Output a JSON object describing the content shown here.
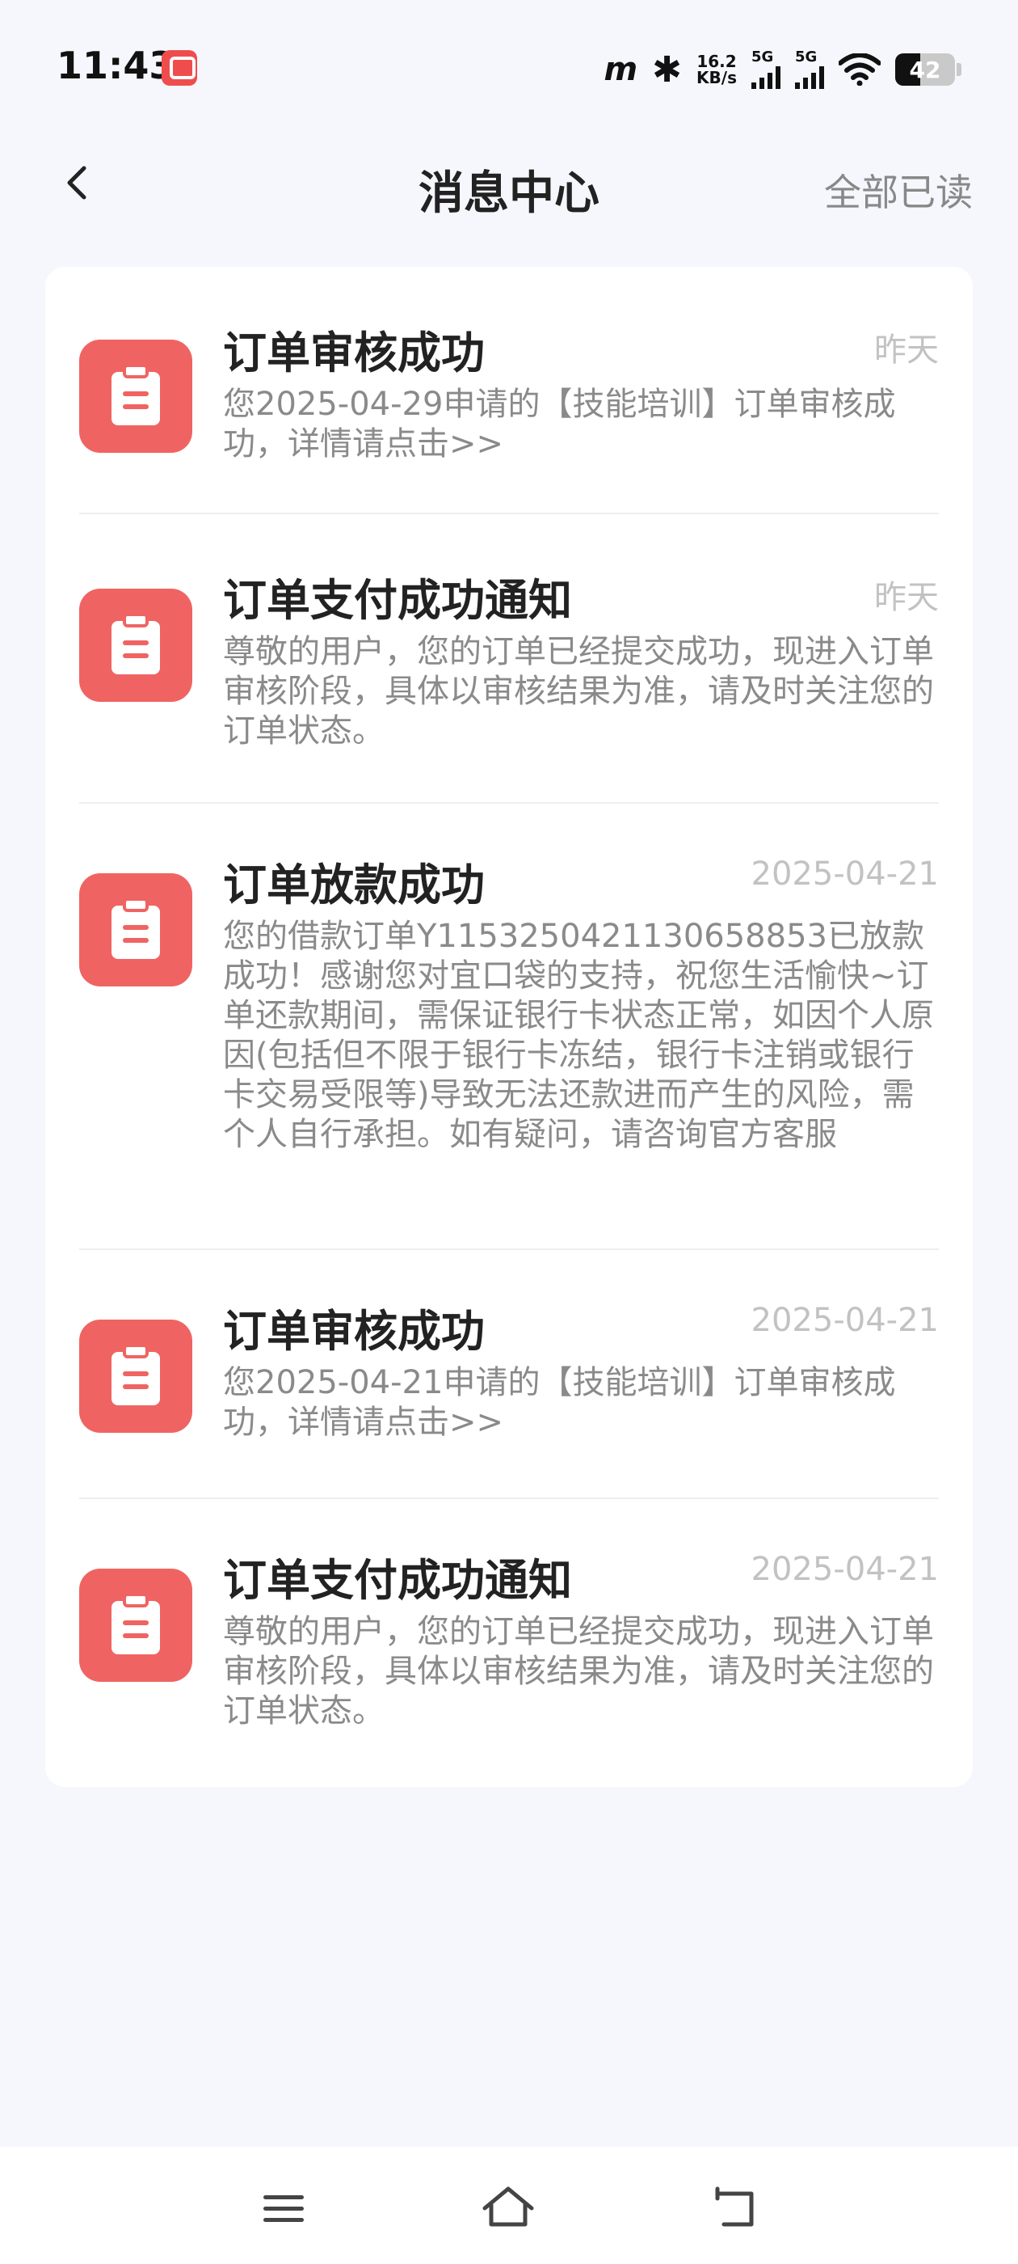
{
  "status_bar": {
    "time": "11:43",
    "carrier_mark": "m",
    "speed_value": "16.2",
    "speed_unit": "KB/s",
    "sim1_label": "5G",
    "sim2_label": "5G",
    "battery": "42"
  },
  "header": {
    "title": "消息中心",
    "mark_all_read": "全部已读"
  },
  "messages": [
    {
      "title": "订单审核成功",
      "time": "昨天",
      "body": "您2025-04-29申请的【技能培训】订单审核成功，详情请点击>>"
    },
    {
      "title": "订单支付成功通知",
      "time": "昨天",
      "body": "尊敬的用户，您的订单已经提交成功，现进入订单审核阶段，具体以审核结果为准，请及时关注您的订单状态。"
    },
    {
      "title": "订单放款成功",
      "time": "2025-04-21",
      "body": "您的借款订单Y115325042113065885​3已放款成功！感谢您对宜口袋的支持，祝您生活愉快~订单还款期间，需保证银行卡状态正常，如因个人原因(包括但不限于银行卡冻结，银行卡注销或银行卡交易受限等)导致无法还款进而产生的风险，需个人自行承担。如有疑问，请咨询官方客服"
    },
    {
      "title": "订单审核成功",
      "time": "2025-04-21",
      "body": "您2025-04-21申请的【技能培训】订单审核成功，详情请点击>>"
    },
    {
      "title": "订单支付成功通知",
      "time": "2025-04-21",
      "body": "尊敬的用户，您的订单已经提交成功，现进入订单审核阶段，具体以审核结果为准，请及时关注您的订单状态。"
    }
  ],
  "colors": {
    "accent": "#ef6462",
    "background": "#f6f7fc",
    "muted_text": "#8a8a8a",
    "time_text": "#c2c2c2"
  },
  "icons": {
    "back": "chevron-left-icon",
    "message": "clipboard-icon",
    "nav_menu": "menu-icon",
    "nav_home": "home-icon",
    "nav_back": "back-arrow-icon"
  }
}
